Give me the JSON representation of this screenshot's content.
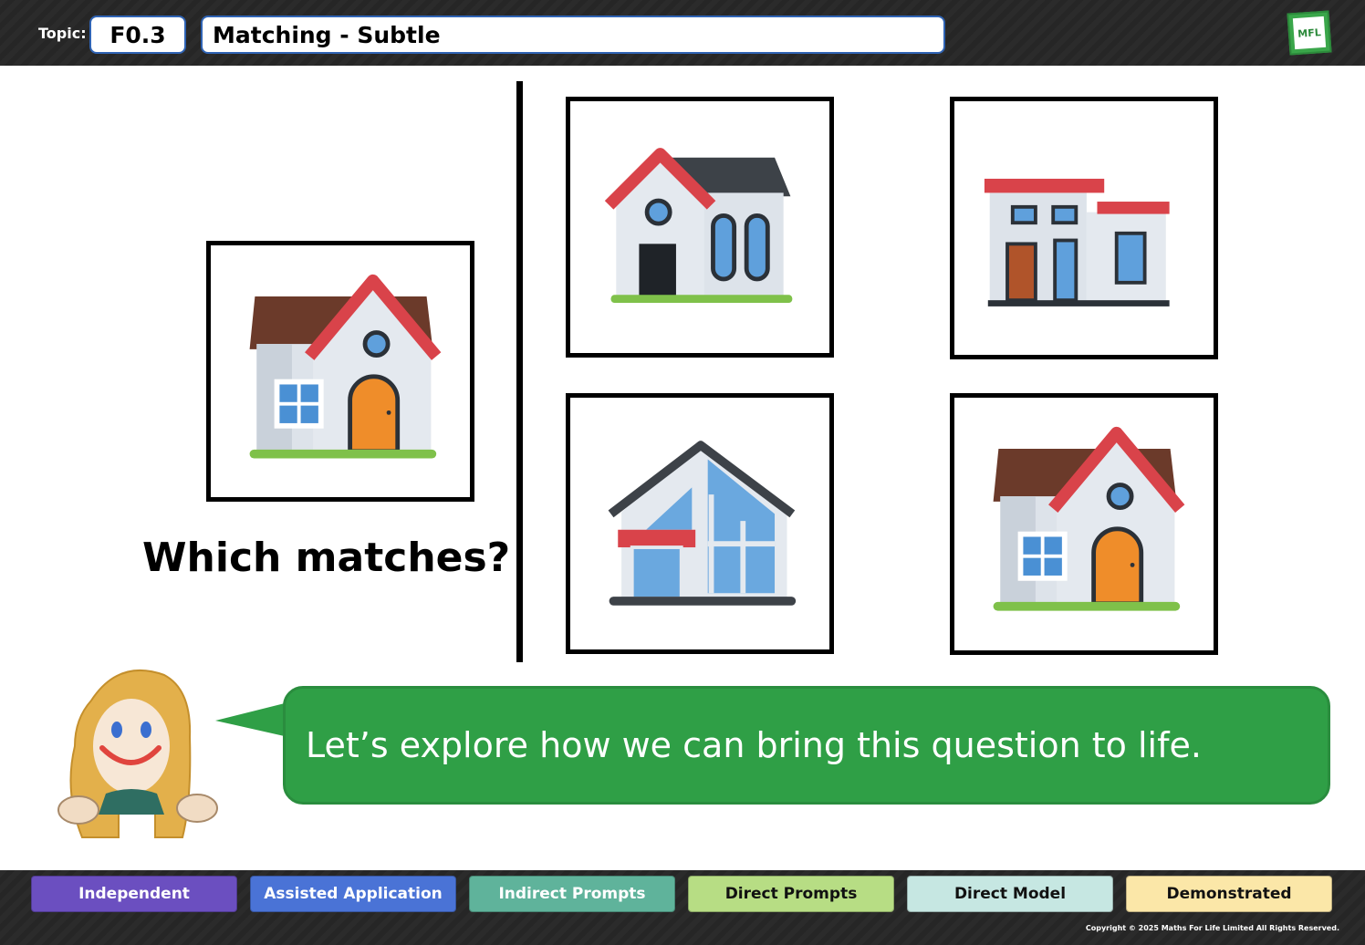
{
  "header": {
    "topic_label": "Topic:",
    "topic_code": "F0.3",
    "title": "Matching - Subtle",
    "logo_text": "MFL"
  },
  "main": {
    "question": "Which matches?",
    "target_card": {
      "icon": "house-red-roof-brown-top-icon"
    },
    "options": [
      {
        "icon": "house-red-gable-dark-roof-icon"
      },
      {
        "icon": "flat-roof-modern-house-icon"
      },
      {
        "icon": "glass-a-frame-house-icon"
      },
      {
        "icon": "house-red-roof-brown-top-icon"
      }
    ]
  },
  "speech": {
    "text": "Let’s explore how we can bring this question to life."
  },
  "footer": {
    "levels": [
      {
        "label": "Independent",
        "color": "#6b4fc0",
        "text_color": "#ffffff"
      },
      {
        "label": "Assisted Application",
        "color": "#4a73d6",
        "text_color": "#ffffff"
      },
      {
        "label": "Indirect Prompts",
        "color": "#5fb39b",
        "text_color": "#ffffff"
      },
      {
        "label": "Direct Prompts",
        "color": "#b7dd84",
        "text_color": "#111111"
      },
      {
        "label": "Direct Model",
        "color": "#c6e7e2",
        "text_color": "#111111"
      },
      {
        "label": "Demonstrated",
        "color": "#fbe7a8",
        "text_color": "#111111"
      }
    ],
    "copyright": "Copyright © 2025 Maths For Life Limited All Rights Reserved."
  },
  "colors": {
    "bubble": "#2f9f46",
    "header_box_border": "#2f63b4"
  }
}
